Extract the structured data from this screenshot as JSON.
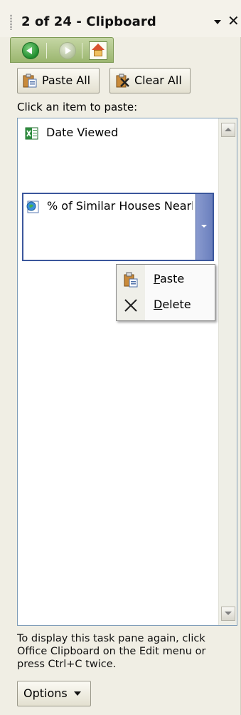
{
  "titlebar": {
    "title": "2 of 24 - Clipboard",
    "dropdown_icon": "chevron-down-icon",
    "close_label": "✕"
  },
  "nav": {
    "back_icon": "back-arrow-icon",
    "forward_icon": "forward-arrow-icon",
    "home_icon": "home-icon"
  },
  "toolbar": {
    "paste_all_label": "Paste All",
    "clear_all_label": "Clear All"
  },
  "instructions": "Click an item to paste:",
  "clipboard_items": [
    {
      "label": "Date Viewed",
      "icon": "excel-item-icon"
    },
    {
      "label": "% of Similar Houses Nearby",
      "icon": "document-item-icon"
    }
  ],
  "context_menu": {
    "items": [
      {
        "label": "Paste",
        "icon": "paste-icon"
      },
      {
        "label": "Delete",
        "icon": "delete-icon"
      }
    ]
  },
  "footer": {
    "help_text": "To display this task pane again, click Office Clipboard on the Edit menu or press Ctrl+C twice.",
    "options_label": "Options"
  },
  "colors": {
    "pane_background": "#f0eee4",
    "selected_border": "#3b579c",
    "nav_green": "#9bb66f"
  }
}
